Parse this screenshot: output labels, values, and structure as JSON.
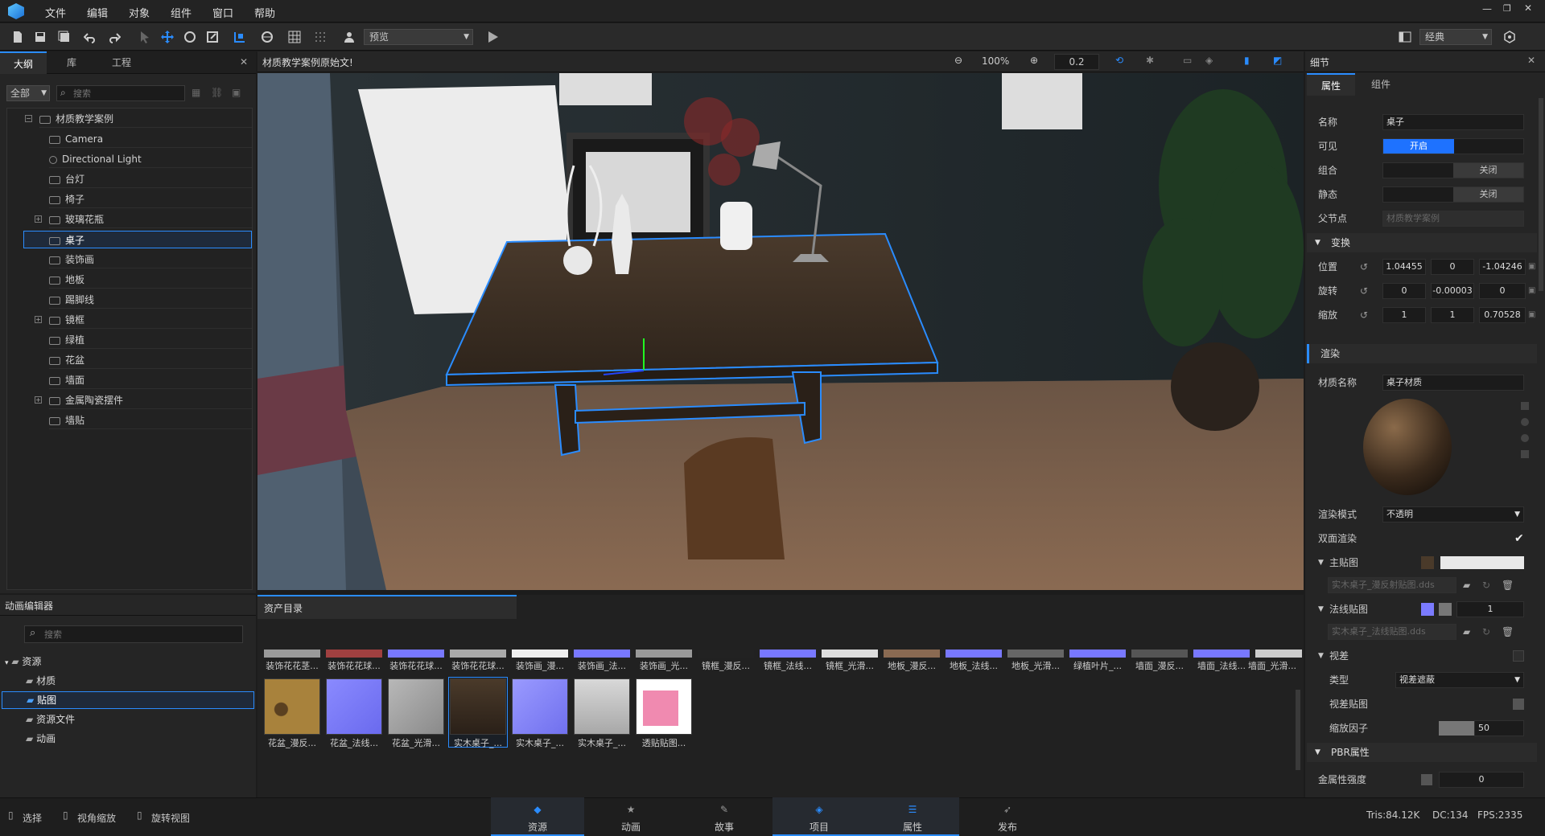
{
  "menu": [
    "文件",
    "编辑",
    "对象",
    "组件",
    "窗口",
    "帮助"
  ],
  "toolbar": {
    "mode_select": "预览",
    "layout_select": "经典"
  },
  "outline": {
    "tabs": [
      "大纲",
      "库",
      "工程"
    ],
    "filter": "全部",
    "search_placeholder": "搜索",
    "items": [
      "材质教学案例",
      "Camera",
      "Directional Light",
      "台灯",
      "椅子",
      "玻璃花瓶",
      "桌子",
      "装饰画",
      "地板",
      "踢脚线",
      "镜框",
      "绿植",
      "花盆",
      "墙面",
      "金属陶瓷摆件",
      "墙贴"
    ]
  },
  "viewport": {
    "title": "材质教学案例原始文!",
    "zoom": "100%",
    "step": "0.2"
  },
  "details": {
    "title": "细节",
    "tabs": [
      "属性",
      "组件"
    ],
    "name_label": "名称",
    "name_value": "桌子",
    "visible_label": "可见",
    "visible_value": "开启",
    "group_label": "组合",
    "group_value": "关闭",
    "static_label": "静态",
    "static_value": "关闭",
    "parent_label": "父节点",
    "parent_value": "材质教学案例",
    "transform": "变换",
    "position_label": "位置",
    "position": [
      "1.04455",
      "0",
      "-1.04246"
    ],
    "rotation_label": "旋转",
    "rotation": [
      "0",
      "-0.00003",
      "0"
    ],
    "scale_label": "缩放",
    "scale": [
      "1",
      "1",
      "0.70528"
    ],
    "render": "渲染",
    "material_label": "材质名称",
    "material_value": "桌子材质",
    "render_mode_label": "渲染模式",
    "render_mode_value": "不透明",
    "double_label": "双面渲染",
    "main_tex_label": "主贴图",
    "main_tex_file": "实木桌子_漫反射贴图.dds",
    "normal_tex_label": "法线贴图",
    "normal_value": "1",
    "normal_tex_file": "实木桌子_法线贴图.dds",
    "parallax_label": "视差",
    "type_label": "类型",
    "type_value": "视差遮蔽",
    "parallax_tex_label": "视差贴图",
    "scale_factor_label": "缩放因子",
    "scale_factor_value": "50",
    "pbr": "PBR属性",
    "metal_label": "金属性强度",
    "metal_value": "0"
  },
  "anim_editor": {
    "title": "动画编辑器",
    "search_placeholder": "搜索",
    "root": "资源",
    "folders": [
      "材质",
      "贴图",
      "资源文件",
      "动画"
    ]
  },
  "assets": {
    "title": "资产目录",
    "row1": [
      "装饰花花茎...",
      "装饰花花球...",
      "装饰花花球...",
      "装饰花花球...",
      "装饰画_漫...",
      "装饰画_法...",
      "装饰画_光...",
      "镜框_漫反...",
      "镜框_法线...",
      "镜框_光滑...",
      "地板_漫反...",
      "地板_法线...",
      "地板_光滑...",
      "绿植叶片_...",
      "墙面_漫反...",
      "墙面_法线...",
      "墙面_光滑..."
    ],
    "row2": [
      "花盆_漫反...",
      "花盆_法线...",
      "花盆_光滑...",
      "实木桌子_...",
      "实木桌子_...",
      "实木桌子_...",
      "透贴贴图..."
    ]
  },
  "status": {
    "select": "选择",
    "zoom_view": "视角缩放",
    "rotate_view": "旋转视图",
    "tris": "Tris:84.12K",
    "dc": "DC:134",
    "fps": "FPS:2335"
  },
  "bottom_tabs": [
    "资源",
    "动画",
    "故事",
    "项目",
    "属性",
    "发布"
  ]
}
